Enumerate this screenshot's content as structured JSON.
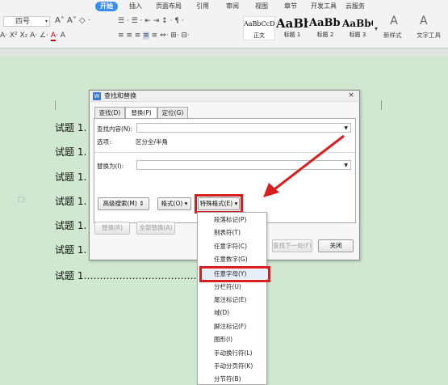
{
  "ribbon": {
    "tabs": [
      "开始",
      "插入",
      "页面布局",
      "引用",
      "审阅",
      "视图",
      "章节",
      "开发工具",
      "云服务"
    ],
    "font_size": "四号",
    "styles": [
      {
        "preview": "AaBbCcDd",
        "name": "正文"
      },
      {
        "preview": "AaBb",
        "name": "标题 1"
      },
      {
        "preview": "AaBb(",
        "name": "标题 2"
      },
      {
        "preview": "AaBbC(",
        "name": "标题 3"
      }
    ],
    "new_style": "新样式",
    "text_tool": "文字工具"
  },
  "doc": {
    "lines": [
      "试题 1.",
      "试题 1.",
      "试题 1.",
      "试题 1.",
      "试题 1.",
      "试题 1.",
      "试题 1……………………………………"
    ]
  },
  "dialog": {
    "icon": "W",
    "title": "查找和替换",
    "close": "×",
    "tabs": [
      "查找(D)",
      "替换(P)",
      "定位(G)"
    ],
    "find_label": "查找内容(N):",
    "options_label": "选项:",
    "options_value": "区分全/半角",
    "replace_label": "替换为(I):",
    "advanced_btn": "高级搜索(M) ⇕",
    "format_btn": "格式(O) ▾",
    "special_btn": "特殊格式(E) ▾",
    "replace_btn": "替换(R)",
    "replace_all_btn": "全部替换(A)",
    "find_next_btn": "查找下一处(F)",
    "close_btn": "关闭"
  },
  "menu": {
    "items": [
      "段落标记(P)",
      "制表符(T)",
      "任意字符(C)",
      "任意数字(G)",
      "任意字母(Y)",
      "分栏符(U)",
      "尾注标记(E)",
      "域(D)",
      "脚注标记(F)",
      "图形(I)",
      "手动换行符(L)",
      "手动分页符(K)",
      "分节符(B)"
    ],
    "selected_index": 4
  },
  "colors": {
    "accent": "#3c8cf0",
    "highlight_red": "#d81e1e",
    "page_bg": "#cfe8cf"
  }
}
